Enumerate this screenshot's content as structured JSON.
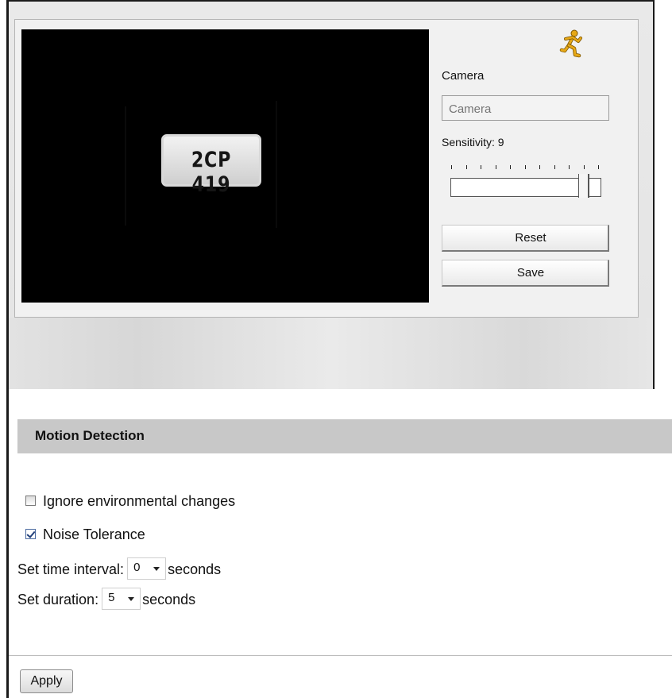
{
  "preview": {
    "plate_state": "",
    "plate_number": "2CP 419"
  },
  "camera": {
    "label": "Camera",
    "placeholder": "Camera"
  },
  "sensitivity": {
    "label": "Sensitivity: 9",
    "value": 9,
    "min": 0,
    "max": 10,
    "tick_count": 11
  },
  "buttons": {
    "reset": "Reset",
    "save": "Save",
    "apply": "Apply"
  },
  "motion_detection": {
    "title": "Motion Detection",
    "ignore_env_label": "Ignore environmental changes",
    "ignore_env_checked": false,
    "noise_tolerance_label": "Noise Tolerance",
    "noise_tolerance_checked": true,
    "time_interval_prefix": "Set time interval:",
    "time_interval_value": "0",
    "time_interval_suffix": "seconds",
    "duration_prefix": "Set duration:",
    "duration_value": "5",
    "duration_suffix": "seconds"
  },
  "icons": {
    "motion_indicator": "running-man-icon",
    "motion_indicator_color": "#e6a817"
  }
}
